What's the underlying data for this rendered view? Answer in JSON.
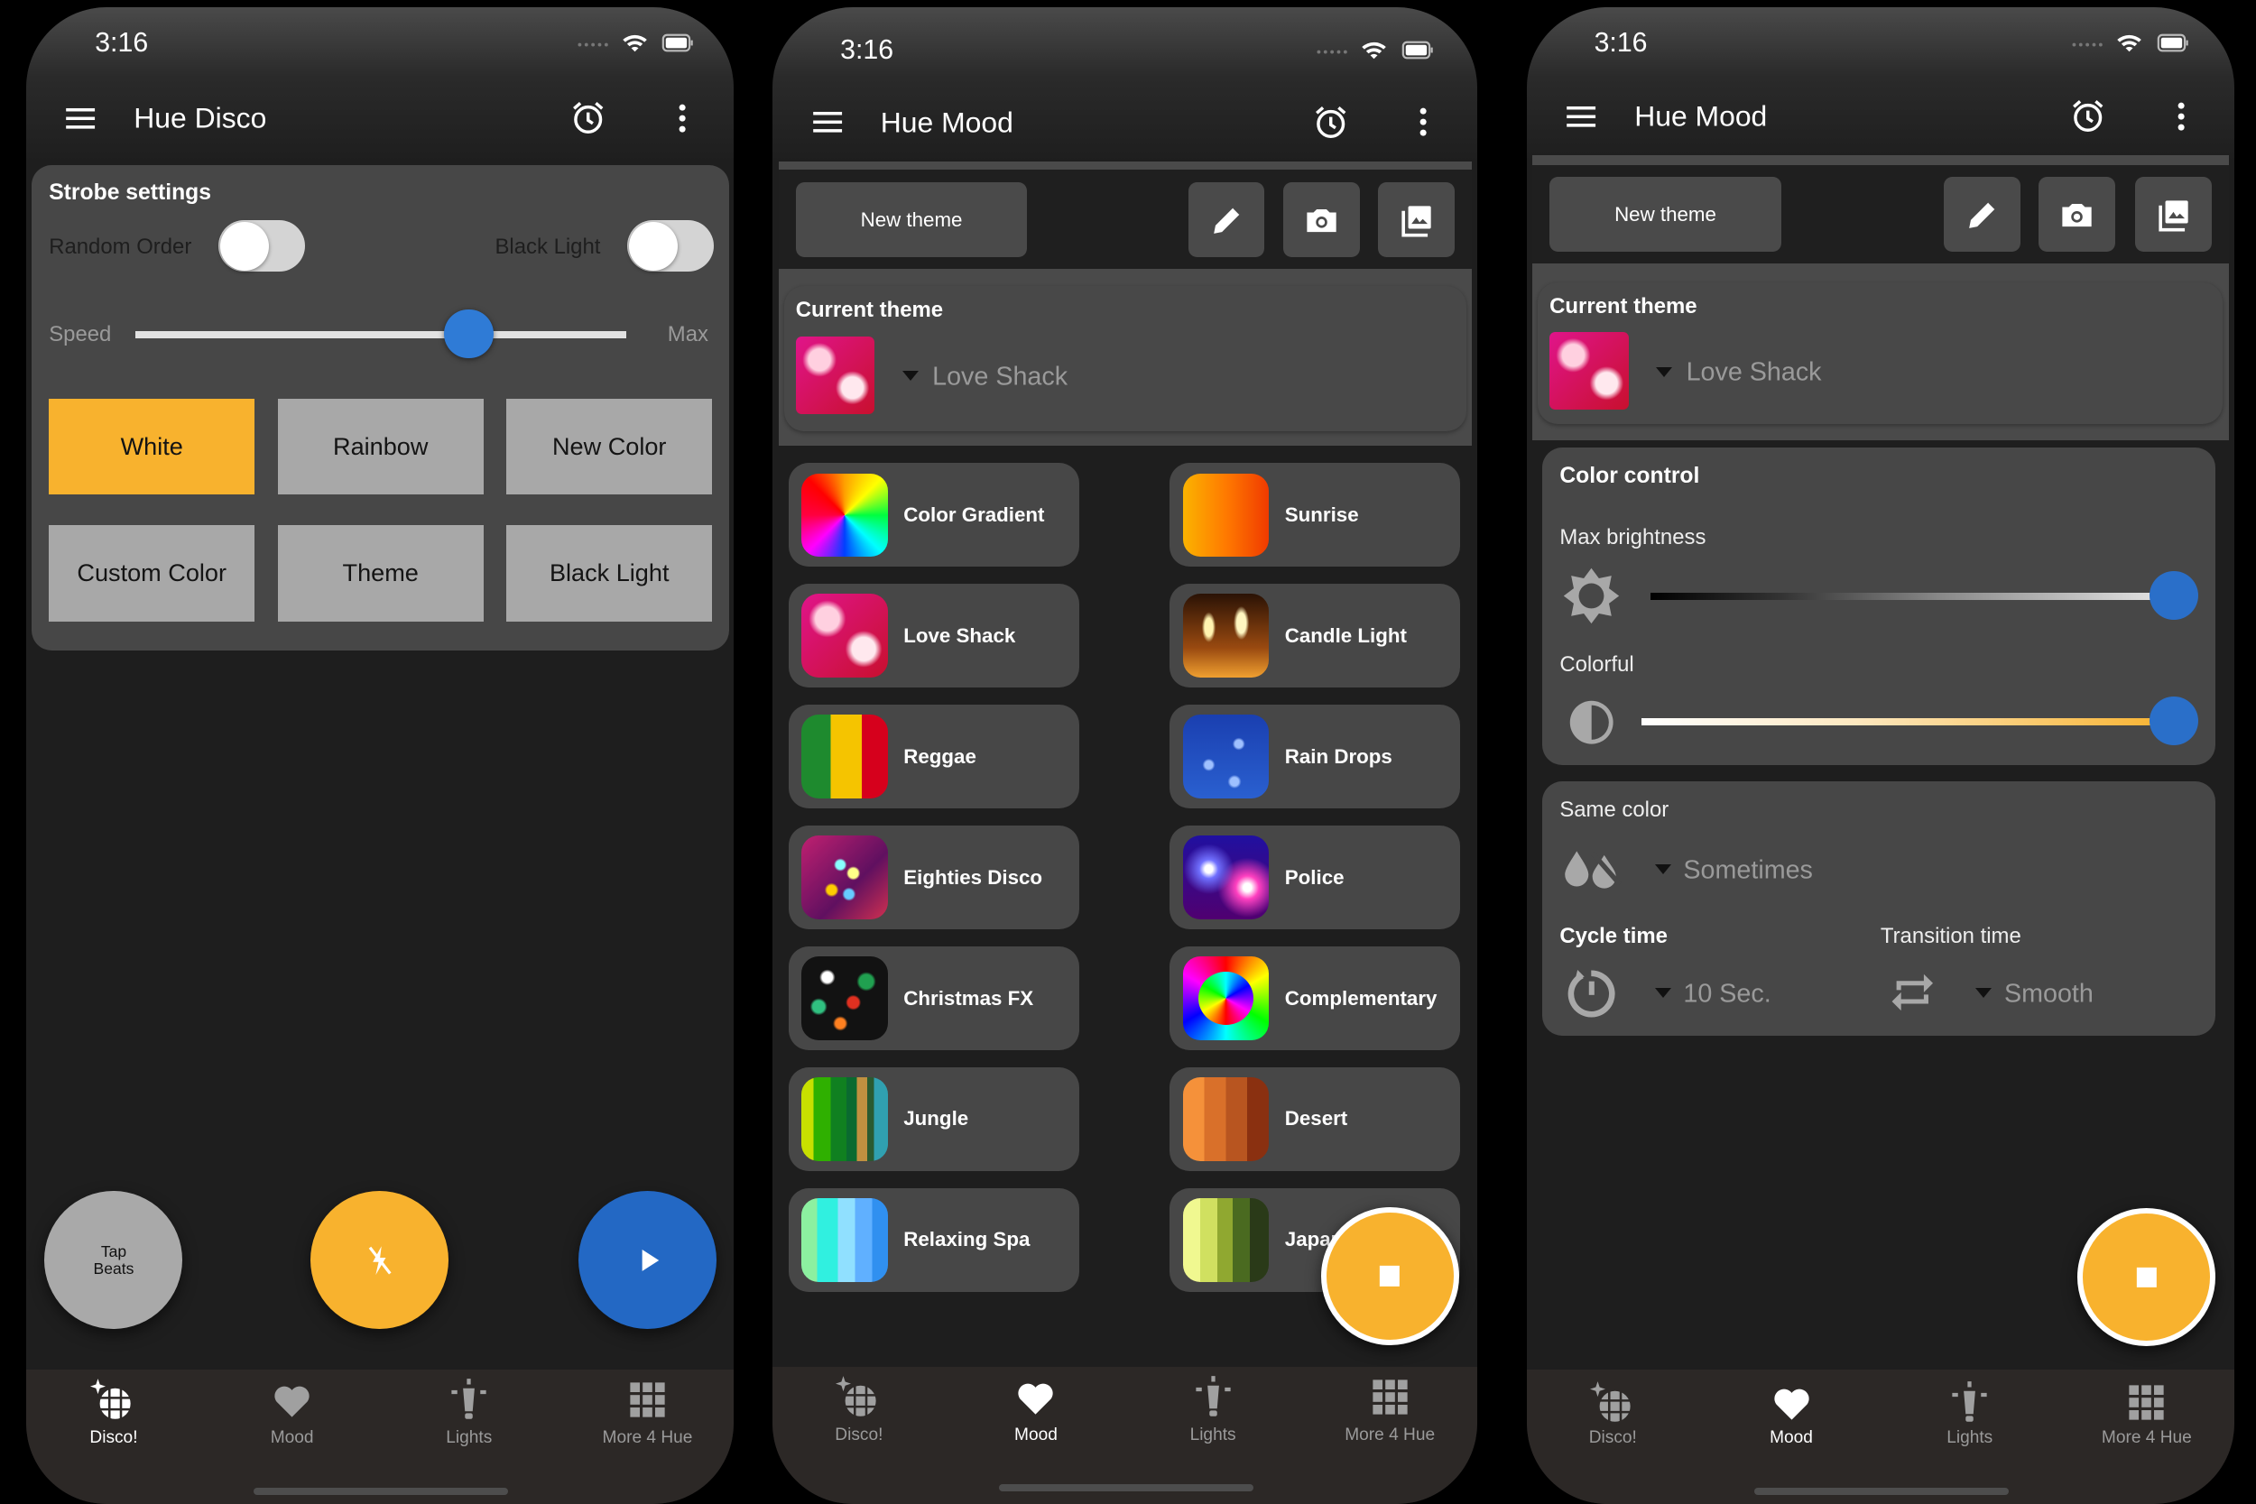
{
  "colors": {
    "accent": "#F8B22E",
    "blue": "#2A6FC9",
    "button_grey": "#A8A8A8"
  },
  "nav": [
    {
      "label": "Disco!",
      "icon": "disco-ball-icon"
    },
    {
      "label": "Mood",
      "icon": "heart-icon"
    },
    {
      "label": "Lights",
      "icon": "lamp-icon"
    },
    {
      "label": "More 4 Hue",
      "icon": "grid-icon"
    }
  ],
  "disco": {
    "status_time": "3:16",
    "title": "Hue Disco",
    "strobe": {
      "title": "Strobe settings",
      "random_order_label": "Random Order",
      "random_order_on": false,
      "black_light_label": "Black Light",
      "black_light_on": false,
      "speed_label": "Speed",
      "speed_max_label": "Max",
      "speed_value": 0.68
    },
    "buttons": [
      {
        "label": "White",
        "selected": true
      },
      {
        "label": "Rainbow",
        "selected": false
      },
      {
        "label": "New Color",
        "selected": false
      },
      {
        "label": "Custom Color",
        "selected": false
      },
      {
        "label": "Theme",
        "selected": false
      },
      {
        "label": "Black Light",
        "selected": false
      }
    ],
    "tap_beats_line1": "Tap",
    "tap_beats_line2": "Beats",
    "active_nav": 0
  },
  "mood_list": {
    "status_time": "3:16",
    "title": "Hue Mood",
    "new_theme_label": "New theme",
    "current_theme_label": "Current theme",
    "current_theme_value": "Love Shack",
    "themes": [
      "Color Gradient",
      "Sunrise",
      "Love Shack",
      "Candle Light",
      "Reggae",
      "Rain Drops",
      "Eighties Disco",
      "Police",
      "Christmas FX",
      "Complementary",
      "Jungle",
      "Desert",
      "Relaxing Spa",
      "Japan"
    ],
    "active_nav": 1
  },
  "mood_control": {
    "status_time": "3:16",
    "title": "Hue Mood",
    "new_theme_label": "New theme",
    "current_theme_label": "Current theme",
    "current_theme_value": "Love Shack",
    "color_control_title": "Color control",
    "max_brightness_label": "Max brightness",
    "max_brightness_value": 1.0,
    "colorful_label": "Colorful",
    "colorful_value": 1.0,
    "same_color_label": "Same color",
    "same_color_value": "Sometimes",
    "cycle_time_label": "Cycle time",
    "cycle_time_value": "10 Sec.",
    "transition_time_label": "Transition time",
    "transition_time_value": "Smooth",
    "active_nav": 1
  }
}
